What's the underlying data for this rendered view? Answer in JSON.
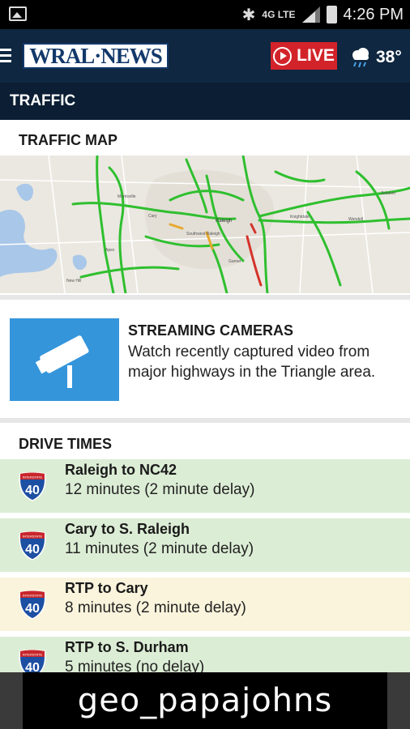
{
  "status_bar": {
    "time": "4:26 PM",
    "network": "4G LTE",
    "icons": [
      "image-icon",
      "bluetooth-icon",
      "signal-icon",
      "battery-icon"
    ]
  },
  "header": {
    "logo_text": "WRAL·NEWS",
    "live_label": "LIVE",
    "weather": {
      "temp": "38°",
      "icon": "rain-cloud-icon"
    },
    "colors": {
      "header_bg": "#0f2740",
      "live_bg": "#d3232a",
      "logo_text": "#13396b"
    }
  },
  "section": {
    "title": "TRAFFIC"
  },
  "traffic_map": {
    "title": "TRAFFIC MAP",
    "labels": [
      "Morrisville",
      "Cary",
      "Raleigh",
      "Southwest Raleigh",
      "Garner",
      "Knightdale",
      "Wendell",
      "Apex",
      "New Hill",
      "Zebulon"
    ]
  },
  "cameras": {
    "title": "STREAMING CAMERAS",
    "description": "Watch recently captured video from major highways in the Triangle area."
  },
  "drive_times": {
    "title": "DRIVE TIMES",
    "rows": [
      {
        "route": "Raleigh to NC42",
        "time": "12 minutes (2 minute delay)",
        "status": "green",
        "shield": "40"
      },
      {
        "route": "Cary to S. Raleigh",
        "time": "11 minutes (2 minute delay)",
        "status": "green",
        "shield": "40"
      },
      {
        "route": "RTP to Cary",
        "time": "8 minutes (2 minute delay)",
        "status": "yellow",
        "shield": "40"
      },
      {
        "route": "RTP to S. Durham",
        "time": "5 minutes (no delay)",
        "status": "green",
        "shield": "40"
      }
    ],
    "shield_top_text": "INTERSTATE"
  },
  "ad": {
    "text": "geo_papajohns"
  }
}
